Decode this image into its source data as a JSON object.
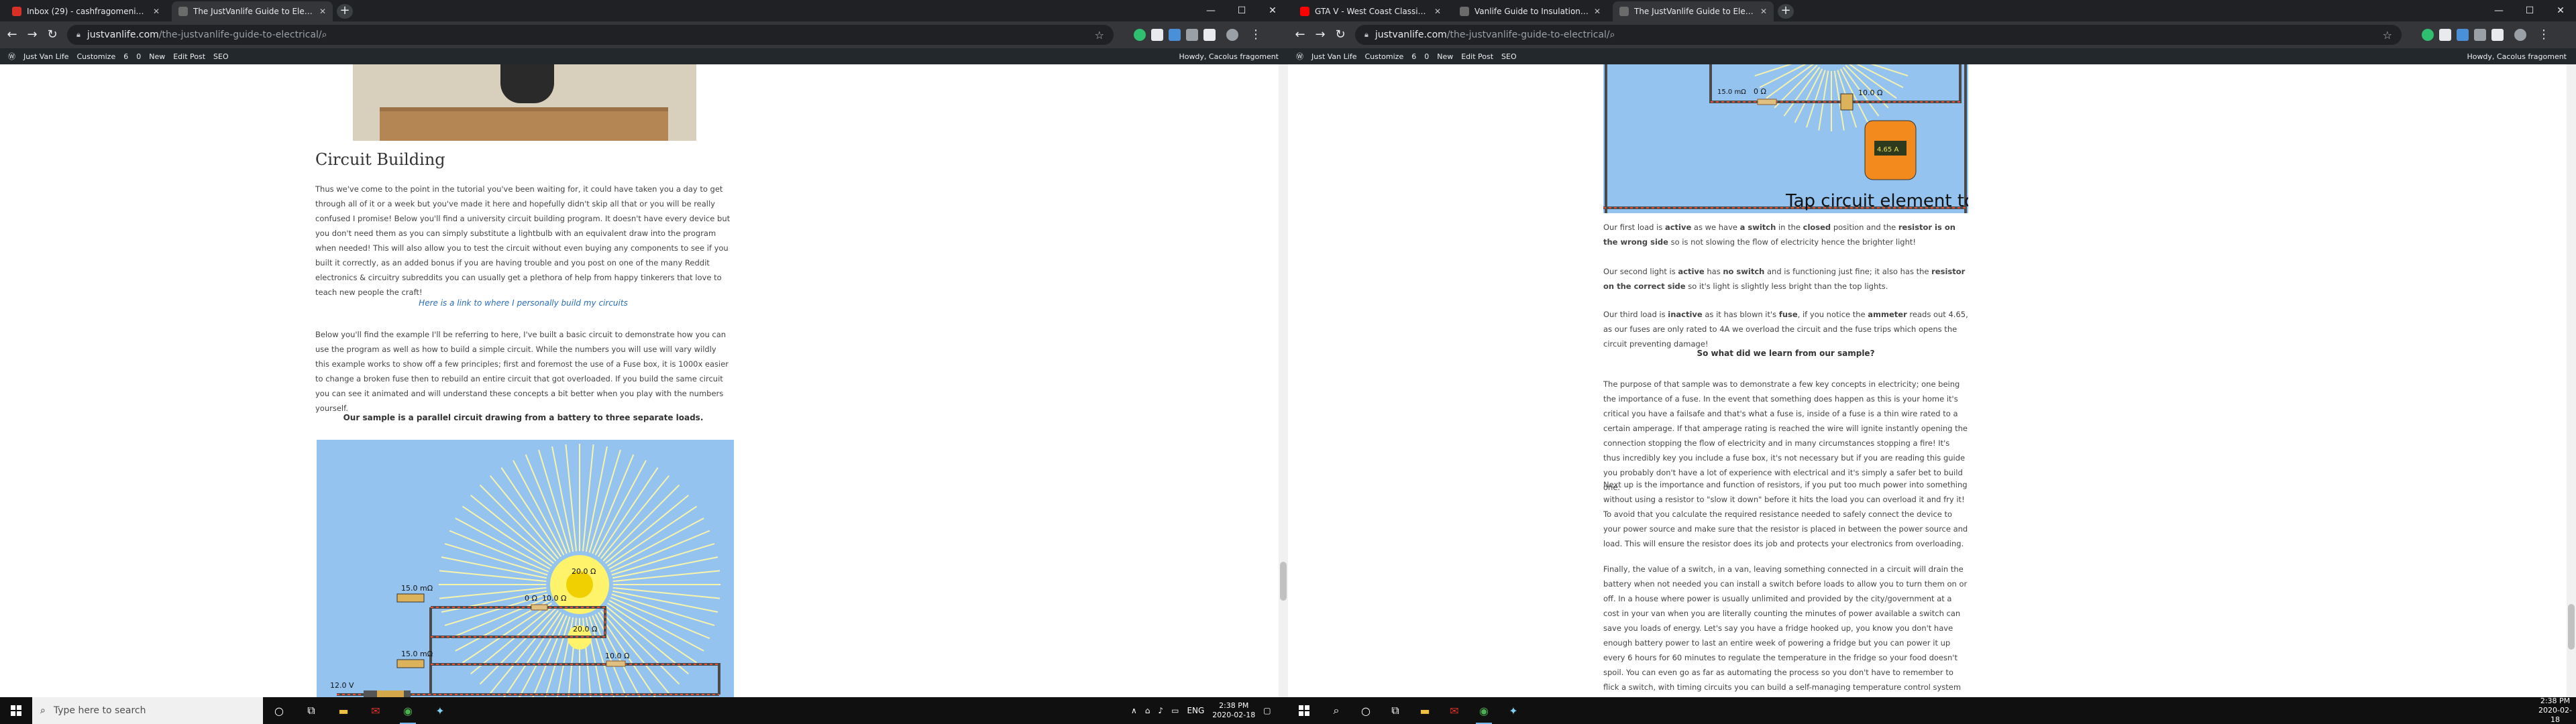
{
  "left": {
    "tabs": [
      {
        "title": "Inbox (29) - cashfragomeni@gm...",
        "favicon_color": "#d93025",
        "active": false
      },
      {
        "title": "The JustVanlife Guide to Electric...",
        "favicon_color": "#6b6b6b",
        "active": true
      }
    ],
    "url": {
      "host": "justvanlife.com",
      "path": "/the-justvanlife-guide-to-electrical/"
    },
    "wp_bar": {
      "site": "Just Van Life",
      "customize": "Customize",
      "updates": "6",
      "comments": "0",
      "new": "New",
      "edit": "Edit Post",
      "seo": "SEO",
      "howdy": "Howdy, Cacolus fragoment"
    },
    "article": {
      "heading": "Circuit Building",
      "para1": "Thus we've come to the point in the tutorial you've been waiting for, it could have taken you a day to get through all of it or a week but you've made it here and hopefully didn't skip all that or you will be really confused I promise! Below you'll find a university circuit building program. It doesn't have every device but you don't need them as you can simply substitute a lightbulb with an equivalent draw into the program when needed! This will also allow you to test the circuit without even buying any components to see if you built it correctly, as an added bonus if you are having trouble and you post on one of the many Reddit electronics & circuitry subreddits you can usually get a plethora of help from happy tinkerers that love to teach new people the craft!",
      "link": "Here is a link to where I personally build my circuits",
      "para2": "Below you'll find the example I'll be referring to here, I've built a basic circuit to demonstrate how you can use the program as well as how to build a simple circuit. While the numbers you will use will vary wildly this example works to show off a few principles; first and foremost the use of a Fuse box, it is 1000x easier to change a broken fuse then to rebuild an entire circuit that got overloaded. If you build the same circuit you can see it animated and will understand these concepts a bit better when you play with the numbers yourself.",
      "caption": "Our sample is a parallel circuit drawing from a battery to three separate loads.",
      "circuit_labels": [
        "20.0 Ω",
        "15.0 mΩ",
        "0 Ω",
        "10.0 Ω",
        "20.0 Ω",
        "15.0 mΩ",
        "10.0 Ω",
        "12.0 V"
      ]
    },
    "taskbar": {
      "search_placeholder": "Type here to search",
      "lang": "ENG",
      "time": "2:38 PM",
      "date": "2020-02-18"
    }
  },
  "right": {
    "tabs": [
      {
        "title": "GTA V - West Coast Classics...",
        "favicon_color": "#ff0000",
        "active": false
      },
      {
        "title": "Vanlife Guide to Insulation | Just...",
        "favicon_color": "#6b6b6b",
        "active": false
      },
      {
        "title": "The JustVanlife Guide to Electric...",
        "favicon_color": "#6b6b6b",
        "active": true
      }
    ],
    "url": {
      "host": "justvanlife.com",
      "path": "/the-justvanlife-guide-to-electrical/"
    },
    "wp_bar": {
      "site": "Just Van Life",
      "customize": "Customize",
      "updates": "6",
      "comments": "0",
      "new": "New",
      "edit": "Edit Post",
      "seo": "SEO",
      "howdy": "Howdy, Cacolus fragoment"
    },
    "article": {
      "circuit_labels": [
        "15.0 mΩ",
        "0 Ω",
        "10.0 Ω",
        "4.65 A"
      ],
      "circuit_caption": "Tap circuit element to edit.",
      "p1": [
        {
          "t": "Our first load is ",
          "b": false
        },
        {
          "t": "active",
          "b": true
        },
        {
          "t": " as we have ",
          "b": false
        },
        {
          "t": "a switch",
          "b": true
        },
        {
          "t": " in the ",
          "b": false
        },
        {
          "t": "closed",
          "b": true
        },
        {
          "t": " position and the ",
          "b": false
        },
        {
          "t": "resistor is on the wrong side",
          "b": true
        },
        {
          "t": " so is not slowing the flow of electricity hence the brighter light!",
          "b": false
        }
      ],
      "p2": [
        {
          "t": "Our second light is ",
          "b": false
        },
        {
          "t": "active",
          "b": true
        },
        {
          "t": " has ",
          "b": false
        },
        {
          "t": "no switch",
          "b": true
        },
        {
          "t": " and is functioning just fine; it also has the ",
          "b": false
        },
        {
          "t": "resistor on the correct side",
          "b": true
        },
        {
          "t": " so it's light is slightly less bright than the top lights.",
          "b": false
        }
      ],
      "p3": [
        {
          "t": "Our third load is ",
          "b": false
        },
        {
          "t": "inactive",
          "b": true
        },
        {
          "t": " as it has blown it's ",
          "b": false
        },
        {
          "t": "fuse",
          "b": true
        },
        {
          "t": ", if you notice the ",
          "b": false
        },
        {
          "t": "ammeter",
          "b": true
        },
        {
          "t": " reads out 4.65, as our fuses are only rated to 4A we overload the circuit and the fuse trips which opens the circuit preventing damage!",
          "b": false
        }
      ],
      "subheading": "So what did we learn from our sample?",
      "p4": "The purpose of that sample was to demonstrate a few key concepts in electricity; one being the importance of a fuse. In the event that something does happen as this is your home it's critical you have a failsafe and that's what a fuse is, inside of a fuse is a thin wire rated to a certain amperage. If that amperage rating is reached the wire will ignite instantly opening the connection stopping the flow of electricity and in many circumstances stopping a fire! It's thus incredibly key you include a fuse box, it's not necessary but if you are reading this guide you probably don't have a lot of experience with electrical and it's simply a safer bet to build one.",
      "p5": "Next up is the importance and function of resistors, if you put too much power into something without using a resistor to \"slow it down\" before it hits the load you can overload it and fry it! To avoid that you calculate the required resistance needed to safely connect the device to your power source and make sure that the resistor is placed in between the power source and load. This will ensure the resistor does its job and protects your electronics from overloading.",
      "p6": "Finally, the value of a switch, in a van, leaving something connected in a circuit will drain the battery when not needed you can install a switch before loads to allow you to turn them on or off. In a house where power is usually unlimited and provided by the city/government at a cost in your van when you are literally counting the minutes of power available a switch can save you loads of energy. Let's say you have a fridge hooked up, you know you don't have enough battery power to last an entire week of powering a fridge but you can power it up every 6 hours for 60 minutes to regulate the temperature in the fridge so your food doesn't spoil. You can even go as far as automating the process so you don't have to remember to flick a switch, with timing circuits you can build a self-managing temperature control system right in your van!"
    },
    "taskbar": {
      "time": "2:38 PM",
      "date": "2020-02-18"
    }
  }
}
